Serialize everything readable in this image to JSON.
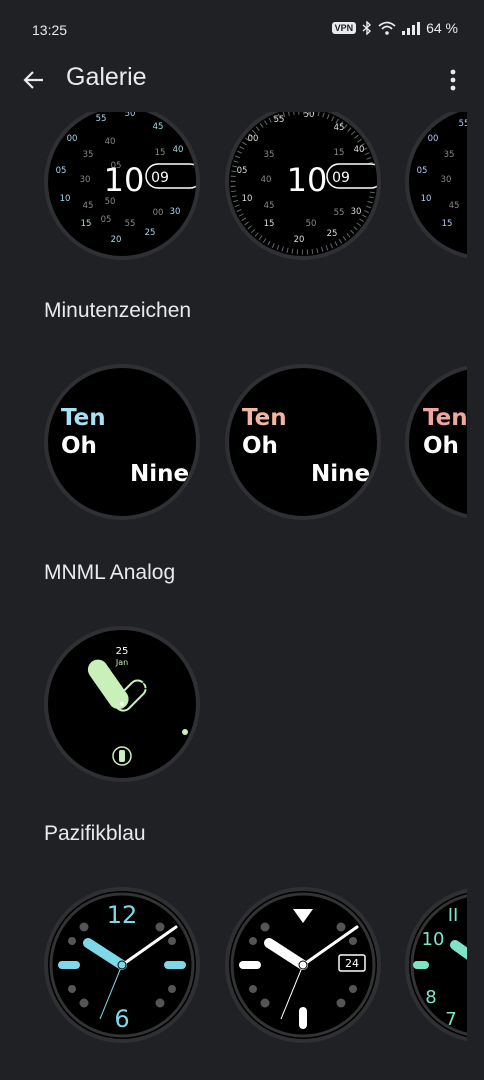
{
  "status": {
    "time": "13:25",
    "vpn": "VPN",
    "battery": "64 %",
    "icons": [
      "vpn-icon",
      "bluetooth-icon",
      "wifi-icon",
      "signal-icon"
    ]
  },
  "app_bar": {
    "title": "Galerie",
    "back_icon": "arrow-back-icon",
    "menu_icon": "more-vert-icon"
  },
  "sections": {
    "first": {
      "faces": [
        {
          "hour": "10",
          "minute": "09"
        },
        {
          "hour": "10",
          "minute": "09"
        },
        {
          "hour": "",
          "minute": ""
        }
      ]
    },
    "minutenzeichen": {
      "title": "Minutenzeichen",
      "faces": [
        {
          "line1": "Ten",
          "line2": "Oh",
          "line3": "Nine",
          "accent": "#a8e0f5"
        },
        {
          "line1": "Ten",
          "line2": "Oh",
          "line3": "Nine",
          "accent": "#f4b6a0"
        },
        {
          "line1": "Ten",
          "line2": "Oh",
          "accent": "#f2a4a0"
        }
      ]
    },
    "mnml": {
      "title": "MNML Analog",
      "day": "25",
      "month": "Jan",
      "time": "10:08",
      "accent": "#c9f0b8"
    },
    "pazifikblau": {
      "title": "Pazifikblau",
      "faces": [
        {
          "n12": "12",
          "n6": "6",
          "accent": "#7fd8e8"
        },
        {
          "date": "24",
          "accent": "#ffffff"
        },
        {
          "n12": "II",
          "n10": "10",
          "n8": "8",
          "n7": "7",
          "accent": "#7fe3c8"
        }
      ]
    }
  }
}
